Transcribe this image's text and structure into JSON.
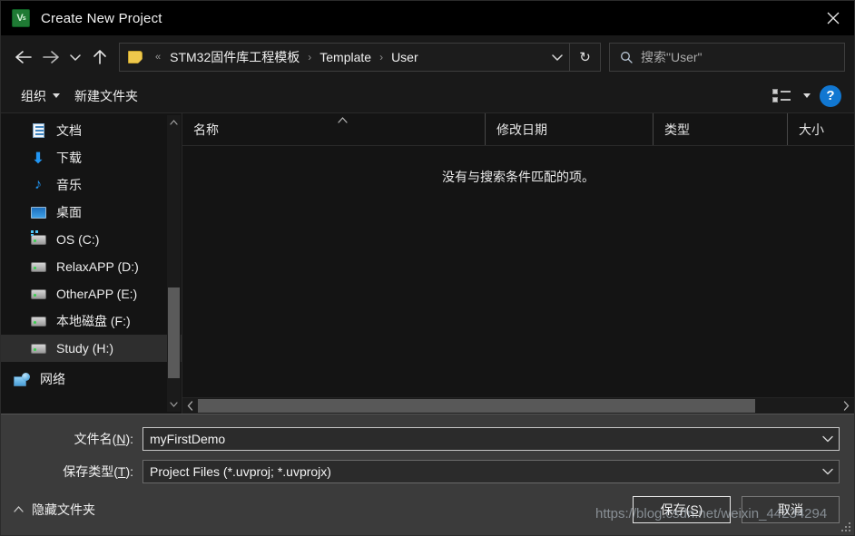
{
  "window": {
    "title": "Create New Project",
    "app_icon": "keil-uvision-icon",
    "close_label": "✕"
  },
  "nav": {
    "back": "back-arrow",
    "forward": "forward-arrow",
    "recent": "recent-dropdown",
    "up": "up-arrow",
    "breadcrumb": {
      "folder_icon": "folder-icon",
      "overflow": "«",
      "items": [
        "STM32固件库工程模板",
        "Template",
        "User"
      ],
      "separator": "›"
    },
    "address_dropdown": "chevron-down-icon",
    "refresh": "↻",
    "search": {
      "icon": "search-icon",
      "placeholder": "搜索\"User\""
    }
  },
  "toolbar": {
    "organize_label": "组织",
    "new_folder_label": "新建文件夹",
    "view_icon": "view-layout-icon",
    "view_dropdown": "caret-down-icon",
    "help_label": "?"
  },
  "sidebar": {
    "items": [
      {
        "label": "文档",
        "icon": "documents-icon",
        "selected": false
      },
      {
        "label": "下载",
        "icon": "downloads-icon",
        "selected": false
      },
      {
        "label": "音乐",
        "icon": "music-icon",
        "selected": false
      },
      {
        "label": "桌面",
        "icon": "desktop-icon",
        "selected": false
      },
      {
        "label": "OS (C:)",
        "icon": "drive-icon",
        "selected": false
      },
      {
        "label": "RelaxAPP (D:)",
        "icon": "drive-icon",
        "selected": false
      },
      {
        "label": "OtherAPP (E:)",
        "icon": "drive-icon",
        "selected": false
      },
      {
        "label": "本地磁盘 (F:)",
        "icon": "drive-icon",
        "selected": false
      },
      {
        "label": "Study (H:)",
        "icon": "drive-icon",
        "selected": true
      }
    ],
    "network_label": "网络",
    "scroll_up": "⌃",
    "scroll_down": "⌄"
  },
  "filelist": {
    "columns": [
      {
        "label": "名称",
        "sorted": "asc"
      },
      {
        "label": "修改日期",
        "sorted": ""
      },
      {
        "label": "类型",
        "sorted": ""
      },
      {
        "label": "大小",
        "sorted": ""
      }
    ],
    "sort_indicator": "⌃",
    "rows": [],
    "empty_message": "没有与搜索条件匹配的项。",
    "hscroll_left": "‹",
    "hscroll_right": "›"
  },
  "form": {
    "filename": {
      "label_prefix": "文件名(",
      "label_accel": "N",
      "label_suffix": "):",
      "value": "myFirstDemo",
      "chevron": "chevron-down-icon"
    },
    "filetype": {
      "label_prefix": "保存类型(",
      "label_accel": "T",
      "label_suffix": "):",
      "value": "Project Files (*.uvproj; *.uvprojx)",
      "chevron": "chevron-down-icon"
    }
  },
  "footer": {
    "hide_folders_label": "隐藏文件夹",
    "hide_folders_chevron": "⌃",
    "save_prefix": "保存(",
    "save_accel": "S",
    "save_suffix": ")",
    "cancel_label": "取消"
  },
  "watermark": "https://blog.csdn.net/weixin_44234294",
  "colors": {
    "window_bg": "#191919",
    "list_bg": "#141414",
    "panel_bg": "#3b3b3b",
    "accent_blue": "#1177d1",
    "selection": "#2e2e2e",
    "text": "#f0f0f0"
  }
}
